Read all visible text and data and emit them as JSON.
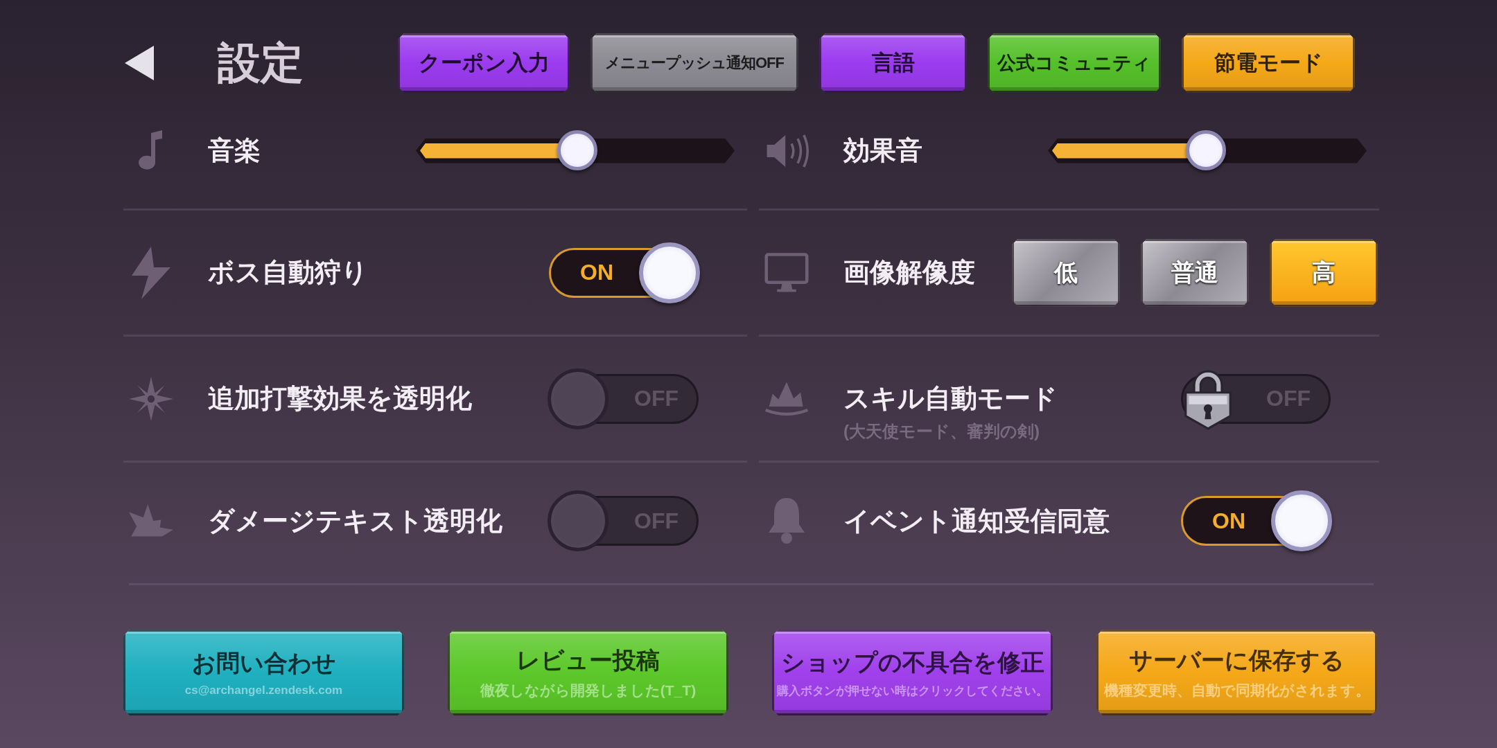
{
  "title": "設定",
  "top_buttons": [
    {
      "label": "クーポン入力",
      "color": "#9b3bef"
    },
    {
      "label": "メニュープッシュ通知OFF",
      "color": "#8c8a92"
    },
    {
      "label": "言語",
      "color": "#9b3bef"
    },
    {
      "label": "公式コミュニティ",
      "color": "#55c02a"
    },
    {
      "label": "節電モード",
      "color": "#f5a818"
    }
  ],
  "settings": [
    {
      "kind": "slider",
      "label": "音楽",
      "level": 0.5
    },
    {
      "kind": "slider",
      "label": "効果音",
      "level": 0.49
    },
    {
      "kind": "toggle",
      "label": "ボス自動狩り",
      "on": true,
      "locked": false,
      "state_text": "ON"
    },
    {
      "kind": "choice",
      "label": "画像解像度",
      "options": [
        {
          "label": "低",
          "selected": false
        },
        {
          "label": "普通",
          "selected": false
        },
        {
          "label": "高",
          "selected": true
        }
      ]
    },
    {
      "kind": "toggle",
      "label": "追加打撃効果を透明化",
      "on": false,
      "locked": false,
      "state_text": "OFF"
    },
    {
      "kind": "toggle",
      "label": "スキル自動モード",
      "note": "(大天使モード、審判の剣)",
      "on": false,
      "locked": true,
      "state_text": "OFF"
    },
    {
      "kind": "toggle",
      "label": "ダメージテキスト透明化",
      "on": false,
      "locked": false,
      "state_text": "OFF"
    },
    {
      "kind": "toggle",
      "label": "イベント通知受信同意",
      "on": true,
      "locked": false,
      "state_text": "ON"
    }
  ],
  "bottom_buttons": [
    {
      "title": "お問い合わせ",
      "subtitle": "cs@archangel.zendesk.com",
      "color": "#1fb0c0"
    },
    {
      "title": "レビュー投稿",
      "subtitle": "徹夜しながら開発しました(T_T)",
      "color": "#5cc82a"
    },
    {
      "title": "ショップの不具合を修正",
      "subtitle": "購入ボタンが押せない時はクリックしてください。",
      "color": "#a040ec"
    },
    {
      "title": "サーバーに保存する",
      "subtitle": "機種変更時、自動で同期化がされます。",
      "color": "#f5a818"
    }
  ]
}
